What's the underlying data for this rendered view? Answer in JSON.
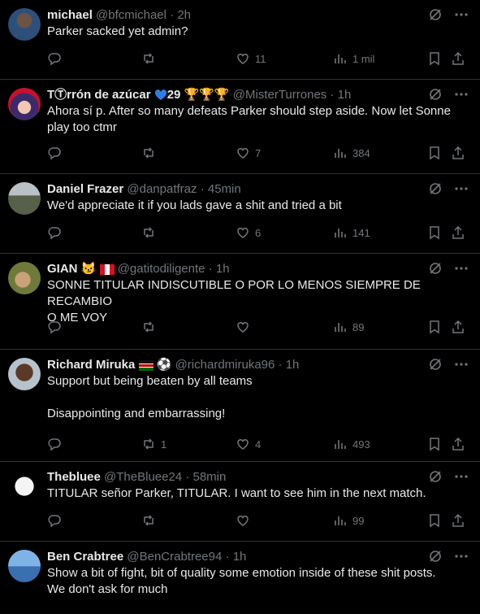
{
  "colors": {
    "background": "#000000",
    "text": "#e7e9ea",
    "muted": "#71767b",
    "divider": "#2f3336"
  },
  "tweets": [
    {
      "name": "michael",
      "handle": "@bfcmichael",
      "time": "2h",
      "lines": [
        "Parker sacked yet admin?"
      ],
      "replies": "",
      "retweets": "",
      "likes": "11",
      "views": "1 mil"
    },
    {
      "name": "TⓉrrón de azúcar",
      "name_suffix": "29",
      "handle": "@MisterTurrones",
      "time": "1h",
      "lines": [
        "Ahora sí p. After so many defeats Parker should step aside. Now let Sonne",
        "play too ctmr"
      ],
      "replies": "",
      "retweets": "",
      "likes": "7",
      "views": "384"
    },
    {
      "name": "Daniel Frazer",
      "handle": "@danpatfraz",
      "time": "45min",
      "lines": [
        "We'd appreciate it if you lads gave a shit and tried a bit"
      ],
      "replies": "",
      "retweets": "",
      "likes": "6",
      "views": "141"
    },
    {
      "name": "GIAN",
      "handle": "@gatitodiligente",
      "time": "1h",
      "lines": [
        "SONNE TITULAR INDISCUTIBLE O POR LO MENOS SIEMPRE DE RECAMBIO",
        "O ME VOY"
      ],
      "replies": "",
      "retweets": "",
      "likes": "",
      "views": "89"
    },
    {
      "name": "Richard Miruka",
      "handle": "@richardmiruka96",
      "time": "1h",
      "lines": [
        "Support but being beaten by all teams",
        "",
        "Disappointing and embarrassing!"
      ],
      "replies": "",
      "retweets": "1",
      "likes": "4",
      "views": "493"
    },
    {
      "name": "Thebluee",
      "handle": "@TheBluee24",
      "time": "58min",
      "lines": [
        "TITULAR señor Parker, TITULAR.  I want to see him in the next match."
      ],
      "replies": "",
      "retweets": "",
      "likes": "",
      "views": "99"
    },
    {
      "name": "Ben Crabtree",
      "handle": "@BenCrabtree94",
      "time": "1h",
      "lines": [
        "Show a bit of fight, bit of quality some emotion inside of these shit posts.",
        "We don't ask for much"
      ],
      "replies": "",
      "retweets": "",
      "likes": "",
      "views": ""
    }
  ]
}
